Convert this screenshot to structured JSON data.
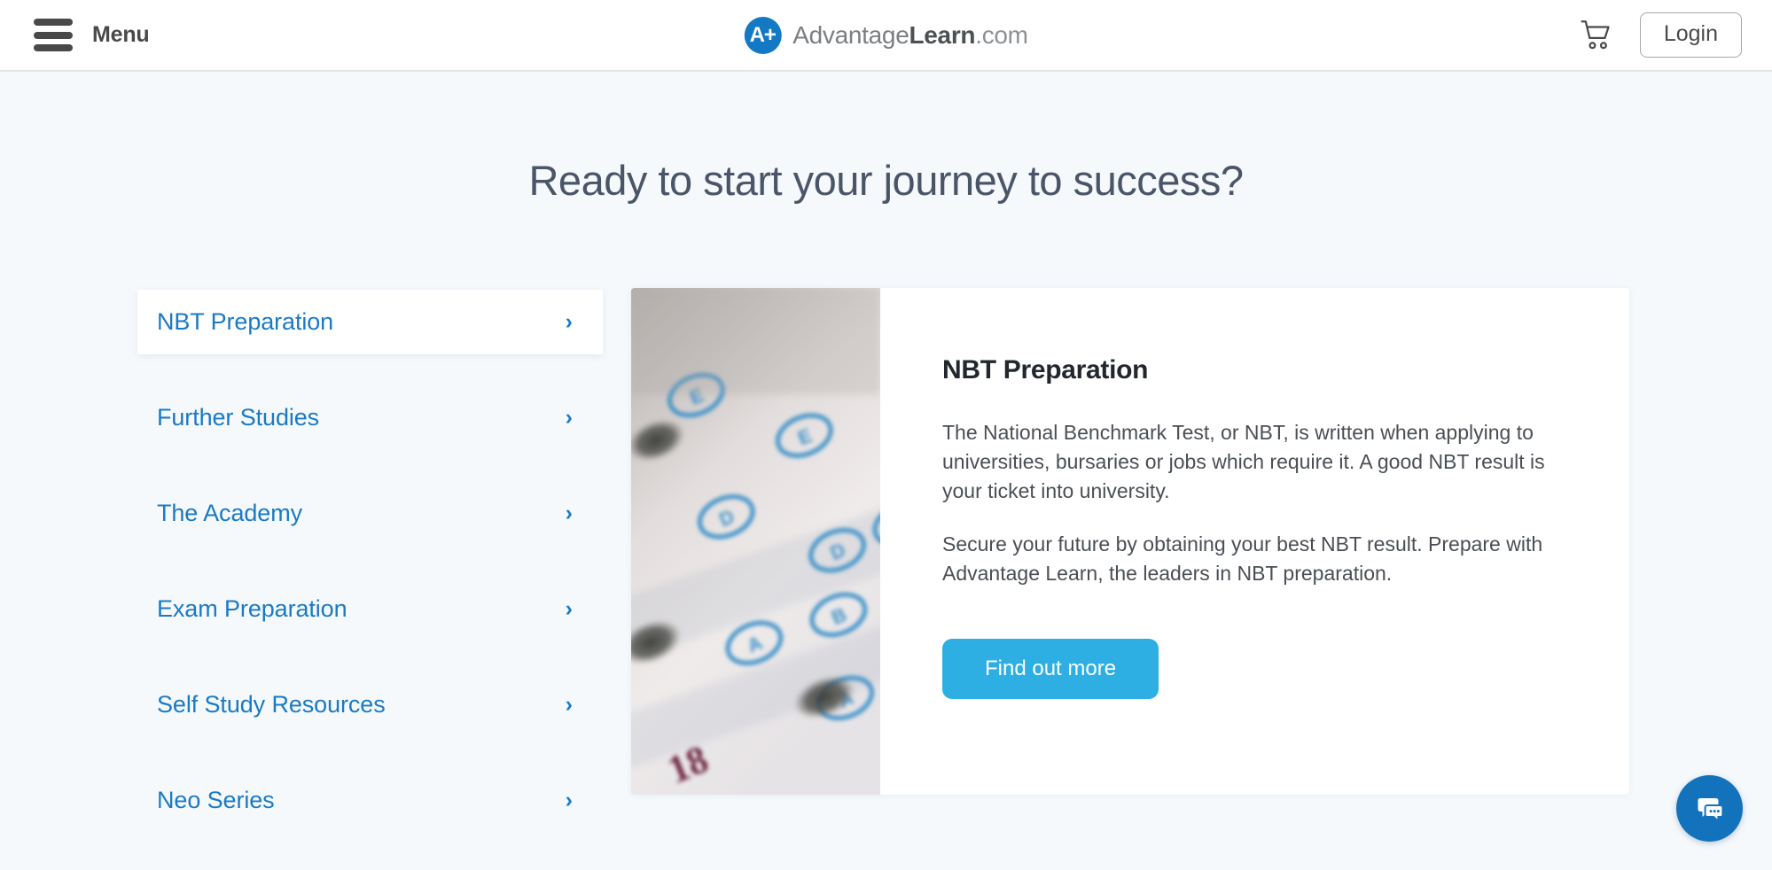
{
  "header": {
    "menu_label": "Menu",
    "hamburger_icon": "hamburger-menu-icon",
    "brand": {
      "badge_text": "A+",
      "name_light": "Advantage",
      "name_bold": "Learn",
      "name_tld": ".com",
      "badge_color": "#1479c4"
    },
    "cart_icon": "shopping-cart-icon",
    "login_label": "Login"
  },
  "main": {
    "heading": "Ready to start your journey to success?",
    "tabs": [
      {
        "label": "NBT Preparation",
        "active": true,
        "chevron": "›"
      },
      {
        "label": "Further Studies",
        "active": false,
        "chevron": "›"
      },
      {
        "label": "The Academy",
        "active": false,
        "chevron": "›"
      },
      {
        "label": "Exam Preparation",
        "active": false,
        "chevron": "›"
      },
      {
        "label": "Self Study Resources",
        "active": false,
        "chevron": "›"
      },
      {
        "label": "Neo Series",
        "active": false,
        "chevron": "›"
      }
    ],
    "panel": {
      "image_alt": "Close-up photograph of a multiple choice answer sheet with lettered bubbles",
      "title": "NBT Preparation",
      "paragraph_1": "The National Benchmark Test, or NBT, is written when applying to universities, bursaries or jobs which require it. A good NBT result is your ticket into university.",
      "paragraph_2": "Secure your future by obtaining your best NBT result. Prepare with Advantage Learn, the leaders in NBT preparation.",
      "cta_label": "Find out more",
      "cta_color": "#2eafe3"
    }
  },
  "chat": {
    "icon": "chat-bubbles-icon",
    "color": "#1273bc"
  },
  "theme": {
    "page_background": "#f5f9fc",
    "link_blue": "#1a7ac4",
    "heading_color": "#4a5568"
  }
}
